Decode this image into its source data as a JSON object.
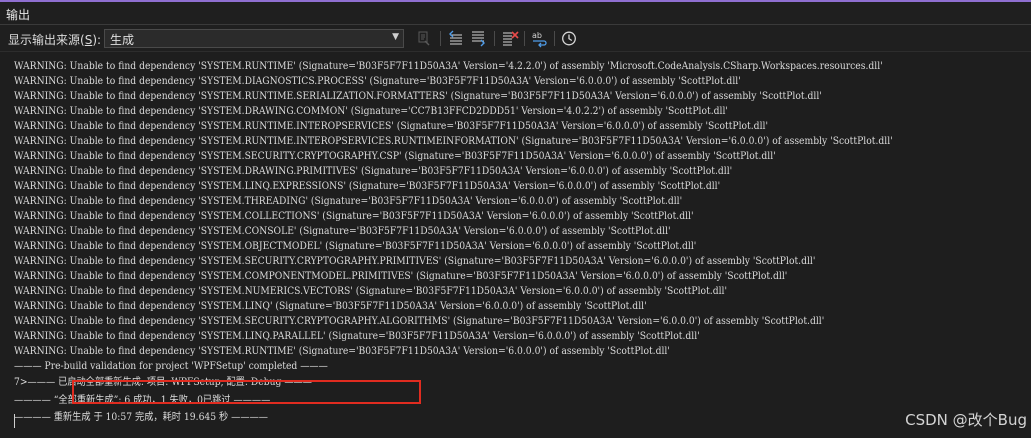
{
  "window": {
    "title": "输出"
  },
  "toolbar": {
    "source_label_prefix": "显示输出来源(",
    "source_label_key": "S",
    "source_label_suffix": "):",
    "source_value": "生成",
    "buttons": [
      "find-message-in-code-icon",
      "previous-message-icon",
      "next-message-icon",
      "clear-all-icon",
      "word-wrap-icon",
      "timestamp-icon"
    ]
  },
  "output": {
    "lines": [
      "WARNING: Unable to find dependency 'SYSTEM.RUNTIME' (Signature='B03F5F7F11D50A3A' Version='4.2.2.0') of assembly 'Microsoft.CodeAnalysis.CSharp.Workspaces.resources.dll'",
      "WARNING: Unable to find dependency 'SYSTEM.DIAGNOSTICS.PROCESS' (Signature='B03F5F7F11D50A3A' Version='6.0.0.0') of assembly 'ScottPlot.dll'",
      "WARNING: Unable to find dependency 'SYSTEM.RUNTIME.SERIALIZATION.FORMATTERS' (Signature='B03F5F7F11D50A3A' Version='6.0.0.0') of assembly 'ScottPlot.dll'",
      "WARNING: Unable to find dependency 'SYSTEM.DRAWING.COMMON' (Signature='CC7B13FFCD2DDD51' Version='4.0.2.2') of assembly 'ScottPlot.dll'",
      "WARNING: Unable to find dependency 'SYSTEM.RUNTIME.INTEROPSERVICES' (Signature='B03F5F7F11D50A3A' Version='6.0.0.0') of assembly 'ScottPlot.dll'",
      "WARNING: Unable to find dependency 'SYSTEM.RUNTIME.INTEROPSERVICES.RUNTIMEINFORMATION' (Signature='B03F5F7F11D50A3A' Version='6.0.0.0') of assembly 'ScottPlot.dll'",
      "WARNING: Unable to find dependency 'SYSTEM.SECURITY.CRYPTOGRAPHY.CSP' (Signature='B03F5F7F11D50A3A' Version='6.0.0.0') of assembly 'ScottPlot.dll'",
      "WARNING: Unable to find dependency 'SYSTEM.DRAWING.PRIMITIVES' (Signature='B03F5F7F11D50A3A' Version='6.0.0.0') of assembly 'ScottPlot.dll'",
      "WARNING: Unable to find dependency 'SYSTEM.LINQ.EXPRESSIONS' (Signature='B03F5F7F11D50A3A' Version='6.0.0.0') of assembly 'ScottPlot.dll'",
      "WARNING: Unable to find dependency 'SYSTEM.THREADING' (Signature='B03F5F7F11D50A3A' Version='6.0.0.0') of assembly 'ScottPlot.dll'",
      "WARNING: Unable to find dependency 'SYSTEM.COLLECTIONS' (Signature='B03F5F7F11D50A3A' Version='6.0.0.0') of assembly 'ScottPlot.dll'",
      "WARNING: Unable to find dependency 'SYSTEM.CONSOLE' (Signature='B03F5F7F11D50A3A' Version='6.0.0.0') of assembly 'ScottPlot.dll'",
      "WARNING: Unable to find dependency 'SYSTEM.OBJECTMODEL' (Signature='B03F5F7F11D50A3A' Version='6.0.0.0') of assembly 'ScottPlot.dll'",
      "WARNING: Unable to find dependency 'SYSTEM.SECURITY.CRYPTOGRAPHY.PRIMITIVES' (Signature='B03F5F7F11D50A3A' Version='6.0.0.0') of assembly 'ScottPlot.dll'",
      "WARNING: Unable to find dependency 'SYSTEM.COMPONENTMODEL.PRIMITIVES' (Signature='B03F5F7F11D50A3A' Version='6.0.0.0') of assembly 'ScottPlot.dll'",
      "WARNING: Unable to find dependency 'SYSTEM.NUMERICS.VECTORS' (Signature='B03F5F7F11D50A3A' Version='6.0.0.0') of assembly 'ScottPlot.dll'",
      "WARNING: Unable to find dependency 'SYSTEM.LINQ' (Signature='B03F5F7F11D50A3A' Version='6.0.0.0') of assembly 'ScottPlot.dll'",
      "WARNING: Unable to find dependency 'SYSTEM.SECURITY.CRYPTOGRAPHY.ALGORITHMS' (Signature='B03F5F7F11D50A3A' Version='6.0.0.0') of assembly 'ScottPlot.dll'",
      "WARNING: Unable to find dependency 'SYSTEM.LINQ.PARALLEL' (Signature='B03F5F7F11D50A3A' Version='6.0.0.0') of assembly 'ScottPlot.dll'",
      "WARNING: Unable to find dependency 'SYSTEM.RUNTIME' (Signature='B03F5F7F11D50A3A' Version='6.0.0.0') of assembly 'ScottPlot.dll'",
      "——— Pre-build validation for project 'WPFSetup' completed ———",
      "7>——— 已启动全部重新生成: 项目: WPFSetup, 配置: Debug ———",
      "———— “全部重新生成”: 6 成功，1 失败，0已跳过 ————",
      "———— 重新生成 于 10:57 完成，耗时 19.645 秒 ————"
    ]
  },
  "watermark": "CSDN @改个Bug",
  "colors": {
    "accent": "#8f6fd0",
    "background": "#1e1e1e",
    "text": "#dcdcdc",
    "highlight_box": "#e02c20"
  }
}
